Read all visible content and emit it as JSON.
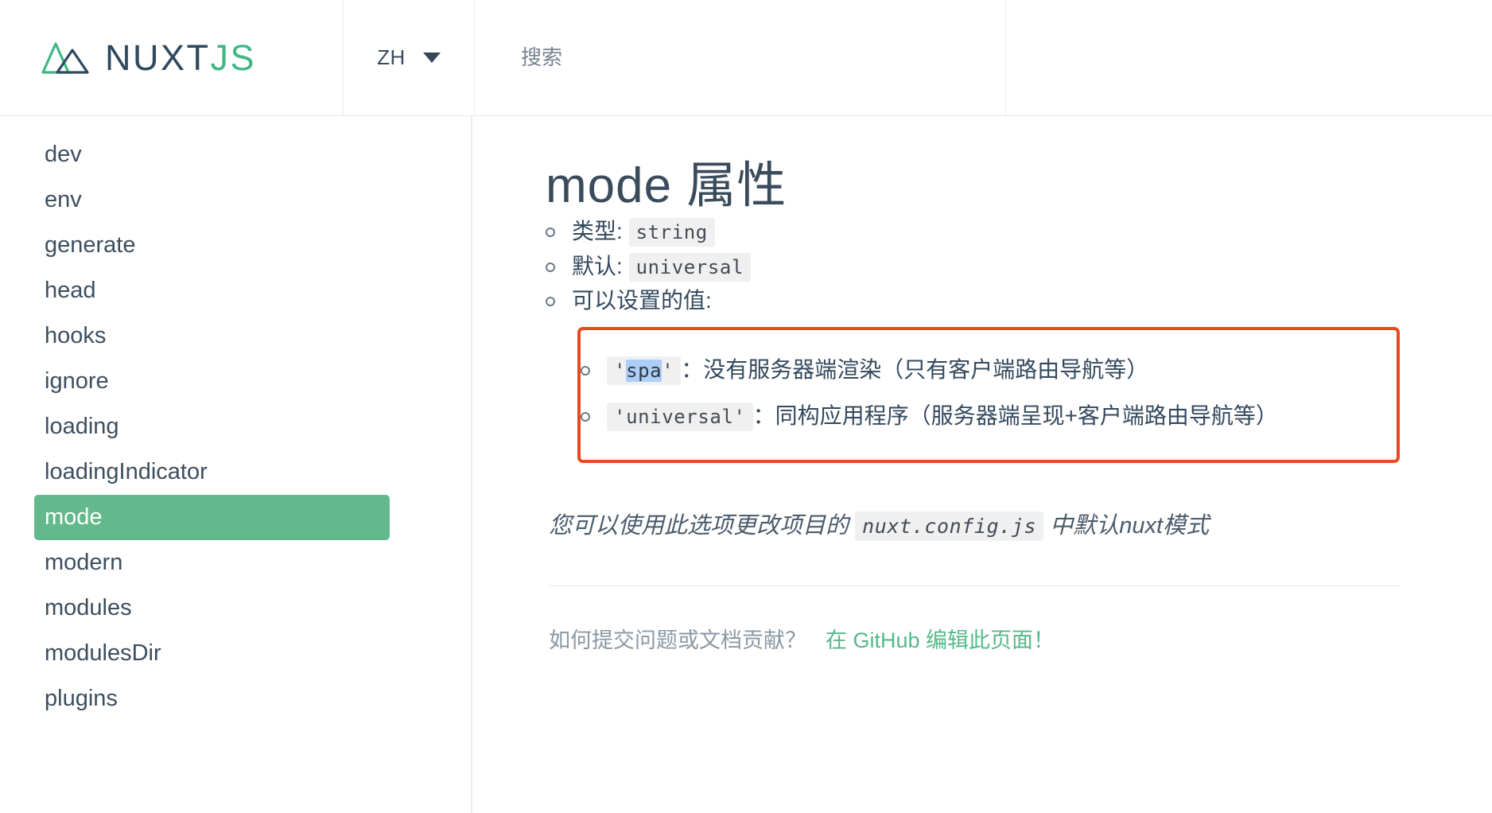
{
  "header": {
    "logo": {
      "primary": "NUXT",
      "accent": "JS",
      "icon": "nuxt-triangle-logo"
    },
    "language": {
      "label": "ZH",
      "caret_icon": "chevron-down-icon"
    },
    "search": {
      "placeholder": "搜索",
      "value": ""
    }
  },
  "sidebar": {
    "items": [
      {
        "label": "dev",
        "active": false
      },
      {
        "label": "env",
        "active": false
      },
      {
        "label": "generate",
        "active": false
      },
      {
        "label": "head",
        "active": false
      },
      {
        "label": "hooks",
        "active": false
      },
      {
        "label": "ignore",
        "active": false
      },
      {
        "label": "loading",
        "active": false
      },
      {
        "label": "loadingIndicator",
        "active": false
      },
      {
        "label": "mode",
        "active": true
      },
      {
        "label": "modern",
        "active": false
      },
      {
        "label": "modules",
        "active": false
      },
      {
        "label": "modulesDir",
        "active": false
      },
      {
        "label": "plugins",
        "active": false
      }
    ]
  },
  "main": {
    "title": "mode 属性",
    "type_label": "类型:",
    "type_value": "string",
    "default_label": "默认:",
    "default_value": "universal",
    "values_label": "可以设置的值:",
    "values": [
      {
        "code_open_quote": "'",
        "code_name": "spa",
        "code_close_quote": "'",
        "selected": true,
        "description": "：没有服务器端渲染（只有客户端路由导航等）"
      },
      {
        "code_open_quote": "'",
        "code_name": "universal",
        "code_close_quote": "'",
        "selected": false,
        "description": "：同构应用程序（服务器端呈现+客户端路由导航等）"
      }
    ],
    "note_before": "您可以使用此选项更改项目的",
    "note_code": "nuxt.config.js",
    "note_after": "中默认nuxt模式",
    "footer_question": "如何提交问题或文档贡献？",
    "footer_link": "在 GitHub 编辑此页面！"
  },
  "colors": {
    "brand_green": "#41b883",
    "active_green": "#63b98b",
    "highlight_red": "#e8491f",
    "selection_blue": "#accef7",
    "dark_text": "#34495e"
  }
}
